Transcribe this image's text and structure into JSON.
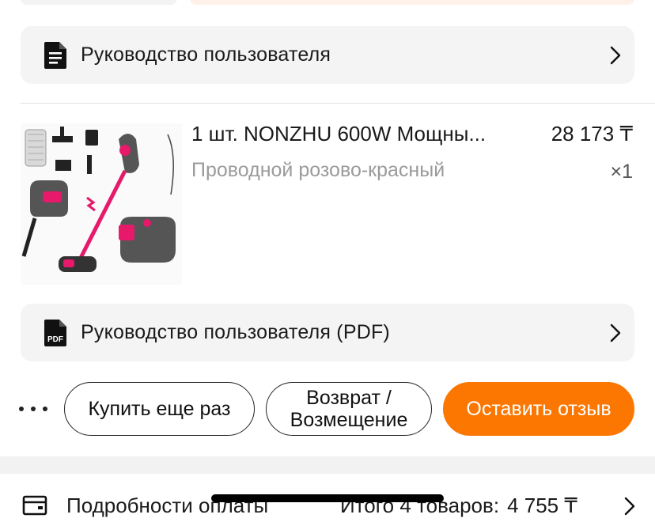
{
  "manual_row": {
    "label": "Руководство пользователя",
    "icon": "document-icon"
  },
  "product": {
    "title": "1 шт. NONZHU 600W Мощны...",
    "variant": "Проводной розово-красный",
    "price": "28 173 ₸",
    "quantity": "×1"
  },
  "manual_pdf_row": {
    "label": "Руководство пользователя (PDF)",
    "icon": "pdf-icon",
    "badge": "PDF"
  },
  "actions": {
    "more": "more-dots-icon",
    "buy_again": "Купить еще раз",
    "return_line1": "Возврат /",
    "return_line2": "Возмещение",
    "review": "Оставить отзыв"
  },
  "payment": {
    "label": "Подробности оплаты",
    "total_label": "Итого 4 товаров:",
    "total_amount": "4 755 ₸"
  },
  "colors": {
    "accent": "#fb7701",
    "product_pink": "#e6196b"
  }
}
